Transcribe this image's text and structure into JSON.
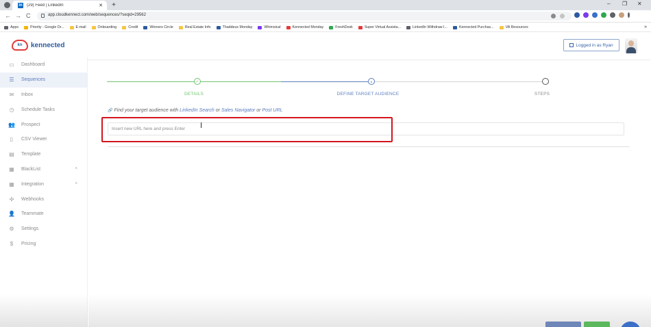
{
  "browser": {
    "tab_title": "(29) Feed | LinkedIn",
    "tab_icon_letter": "in",
    "new_tab": "+",
    "url": "app.cloudkennect.com/web/sequences/?seqid=29562",
    "window_controls": [
      "–",
      "❐",
      "✕"
    ],
    "nav": {
      "back": "←",
      "forward": "→",
      "reload": "C"
    },
    "bookmarks": [
      {
        "label": "Apps",
        "color": "#5f6368"
      },
      {
        "label": "Priority - Google Dr...",
        "color": "#f4b400"
      },
      {
        "label": "E-mail",
        "color": "#f6c544"
      },
      {
        "label": "Onboarding",
        "color": "#f6c544"
      },
      {
        "label": "Credit",
        "color": "#f6c544"
      },
      {
        "label": "Winners Circle",
        "color": "#2b5aa0"
      },
      {
        "label": "Real Estate Info",
        "color": "#f6c544"
      },
      {
        "label": "Thaddeus Monday",
        "color": "#2b5aa0"
      },
      {
        "label": "Whimsical",
        "color": "#7c3aed"
      },
      {
        "label": "Kennected Monday",
        "color": "#e23b3b"
      },
      {
        "label": "FreshDesk",
        "color": "#2fa84f"
      },
      {
        "label": "Super Virtual Assista...",
        "color": "#e23b3b"
      },
      {
        "label": "LinkedIn Withdraw I...",
        "color": "#5f6368"
      },
      {
        "label": "Kennected Purchas...",
        "color": "#2b5aa0"
      },
      {
        "label": "VA Resources",
        "color": "#f6c544"
      }
    ],
    "bookmarks_overflow": "»"
  },
  "header": {
    "brand": "kennected",
    "logo_letters": "kn",
    "logged_in_label": "Logged in as Ryan"
  },
  "sidebar": {
    "items": [
      {
        "label": "Dashboard",
        "icon": "monitor-icon",
        "glyph": "▭"
      },
      {
        "label": "Sequences",
        "icon": "list-icon",
        "glyph": "☰"
      },
      {
        "label": "Inbox",
        "icon": "chat-icon",
        "glyph": "✉"
      },
      {
        "label": "Schedule Tasks",
        "icon": "clock-icon",
        "glyph": "◷"
      },
      {
        "label": "Prospect",
        "icon": "users-icon",
        "glyph": "👥"
      },
      {
        "label": "CSV Viewer",
        "icon": "file-icon",
        "glyph": "▯"
      },
      {
        "label": "Template",
        "icon": "template-icon",
        "glyph": "▤"
      },
      {
        "label": "BlackList",
        "icon": "blacklist-icon",
        "glyph": "▦",
        "caret": "˄"
      },
      {
        "label": "Integration",
        "icon": "integration-icon",
        "glyph": "▦",
        "caret": "˄"
      },
      {
        "label": "Webhooks",
        "icon": "webhook-icon",
        "glyph": "✣"
      },
      {
        "label": "Teammate",
        "icon": "teammate-icon",
        "glyph": "👤"
      },
      {
        "label": "Settings",
        "icon": "gear-icon",
        "glyph": "⚙"
      },
      {
        "label": "Pricing",
        "icon": "dollar-icon",
        "glyph": "$"
      }
    ]
  },
  "stepper": {
    "steps": [
      {
        "label": "DETAILS",
        "state": "done",
        "mark": "✓"
      },
      {
        "label": "DEFINE TARGET AUDIENCE",
        "state": "current",
        "mark": "●"
      },
      {
        "label": "STEPS",
        "state": "pending",
        "mark": ""
      }
    ],
    "colors": {
      "done": "#6fc46f",
      "current": "#5a7cbf",
      "pending": "#555555"
    }
  },
  "main": {
    "find_prefix": "Find your target audience with ",
    "linkedin_search": "LinkedIn Search",
    "or1": " or ",
    "sales_navigator": "Sales Navigator",
    "or2": " or ",
    "post_url": "Post URL",
    "url_placeholder": "Insert new URL here and press Enter",
    "link_icon": "🔗"
  },
  "highlight_color": "#d3141c"
}
